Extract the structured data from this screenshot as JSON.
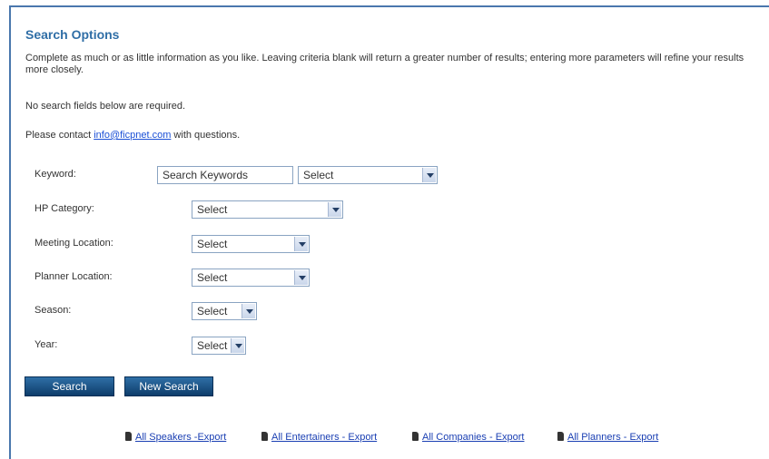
{
  "header": {
    "title": "Search Options",
    "intro": "Complete as much or as little information as you like. Leaving criteria blank will return a greater number of results; entering more parameters will refine your results more closely.",
    "required_note": "No search fields below are required.",
    "contact_prefix": "Please contact ",
    "contact_email": "info@ficpnet.com",
    "contact_suffix": " with questions."
  },
  "form": {
    "keyword": {
      "label": "Keyword:",
      "input_value": "Search Keywords",
      "select_value": "Select"
    },
    "hp_category": {
      "label": "HP Category:",
      "select_value": "Select"
    },
    "meeting_location": {
      "label": "Meeting Location:",
      "select_value": "Select"
    },
    "planner_location": {
      "label": "Planner Location:",
      "select_value": "Select"
    },
    "season": {
      "label": "Season:",
      "select_value": "Select"
    },
    "year": {
      "label": "Year:",
      "select_value": "Select"
    }
  },
  "buttons": {
    "search": "Search",
    "new_search": "New Search"
  },
  "exports": [
    {
      "label": "All Speakers -Export",
      "icon": "export-icon"
    },
    {
      "label": "All Entertainers - Export",
      "icon": "export-icon"
    },
    {
      "label": "All Companies - Export",
      "icon": "export-icon"
    },
    {
      "label": "All Planners - Export",
      "icon": "export-icon"
    }
  ],
  "colors": {
    "title": "#2f6ea6",
    "button": "#1d5487",
    "link": "#1a3fb3",
    "border": "#4a77ad"
  }
}
